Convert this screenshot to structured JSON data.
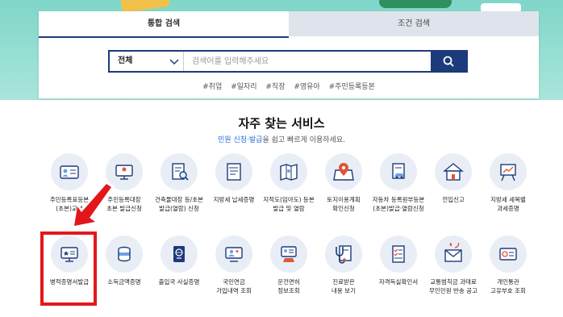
{
  "colors": {
    "navy": "#1d3a7a",
    "banner": "#a9e5da",
    "highlight": "#e3171b",
    "link": "#2a6fd8"
  },
  "search": {
    "tabs": [
      "통합 검색",
      "조건 검색"
    ],
    "category": "전체",
    "placeholder": "검색어를 입력해주세요",
    "hashtags": [
      "#취업",
      "#일자리",
      "#직장",
      "#영유아",
      "#주민등록등본"
    ]
  },
  "section": {
    "title": "자주 찾는 서비스",
    "subtitle_highlight": "민원 신청·발급",
    "subtitle_rest": "을 쉽고 빠르게 이용하세요."
  },
  "services_row1": [
    {
      "label": "주민등록표등본\n(초본)교부",
      "icon": "id-card-icon"
    },
    {
      "label": "주민등록대장\n초본 발급신청",
      "icon": "computer-person-icon"
    },
    {
      "label": "건축물대장 등/초본\n발급(열람) 신청",
      "icon": "document-search-icon"
    },
    {
      "label": "지방세 납세증명",
      "icon": "certificate-icon"
    },
    {
      "label": "지적도(임야도) 등본\n발급 및 열람",
      "icon": "map-icon"
    },
    {
      "label": "토지이용계획\n확인신청",
      "icon": "map-pin-icon"
    },
    {
      "label": "자동차 등록원부등본\n(초본)발급·열람신청",
      "icon": "car-document-icon"
    },
    {
      "label": "전입신고",
      "icon": "house-icon"
    },
    {
      "label": "지방세 세목별\n과세증명",
      "icon": "chart-board-icon"
    }
  ],
  "services_row2": [
    {
      "label": "병적증명서발급",
      "icon": "military-monitor-icon"
    },
    {
      "label": "소득금액증명",
      "icon": "coins-icon"
    },
    {
      "label": "출입국 사실증명",
      "icon": "passport-icon"
    },
    {
      "label": "국민연금\n가입내역 조회",
      "icon": "pension-icon"
    },
    {
      "label": "운전면허\n정보조회",
      "icon": "driver-license-icon"
    },
    {
      "label": "진료받은\n내용 보기",
      "icon": "stethoscope-icon"
    },
    {
      "label": "자격득실확인서",
      "icon": "checklist-icon"
    },
    {
      "label": "교통범칙금 과태료\n무인민원 반송 공고",
      "icon": "mail-return-icon"
    },
    {
      "label": "개인통관\n고유부호 조회",
      "icon": "customs-stamp-icon"
    }
  ]
}
